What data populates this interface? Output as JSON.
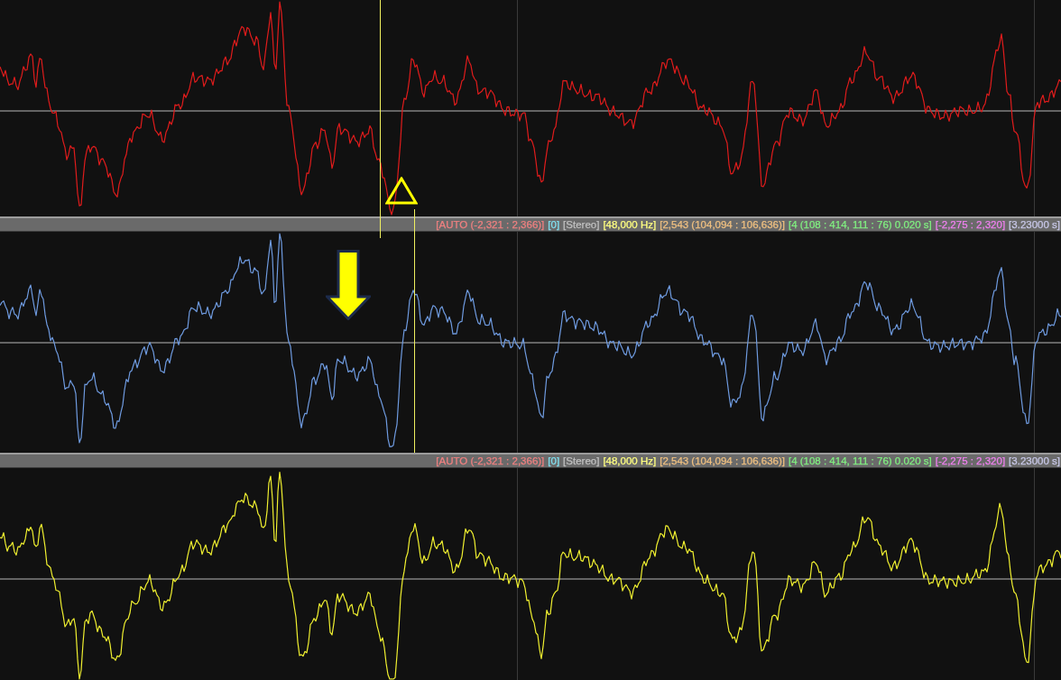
{
  "tracks": [
    {
      "color": "#e01c1c",
      "status_bar": [
        {
          "text": "[AUTO (-2,321 : 2,366)]",
          "color": "#f08080"
        },
        {
          "text": "[0]",
          "color": "#80e0f0"
        },
        {
          "text": "[Stereo]",
          "color": "#c0c0c0"
        },
        {
          "text": "[48,000 Hz]",
          "color": "#ffff80"
        },
        {
          "text": "[2,543 (104,094 : 106,636)]",
          "color": "#f0c080"
        },
        {
          "text": "[4 (108 : 414, 111 : 76) 0.020 s]",
          "color": "#80f080"
        },
        {
          "text": "[-2,275 : 2,320]",
          "color": "#f080f0"
        },
        {
          "text": "[3.23000 s]",
          "color": "#c8c8e8"
        }
      ]
    },
    {
      "color": "#6f9be0",
      "status_bar": [
        {
          "text": "[AUTO (-2,321 : 2,366)]",
          "color": "#f08080"
        },
        {
          "text": "[0]",
          "color": "#80e0f0"
        },
        {
          "text": "[Stereo]",
          "color": "#c0c0c0"
        },
        {
          "text": "[48,000 Hz]",
          "color": "#ffff80"
        },
        {
          "text": "[2,543 (104,094 : 106,636)]",
          "color": "#f0c080"
        },
        {
          "text": "[4 (108 : 414, 111 : 76) 0.020 s]",
          "color": "#80f080"
        },
        {
          "text": "[-2,275 : 2,320]",
          "color": "#f080f0"
        },
        {
          "text": "[3.23000 s]",
          "color": "#c8c8e8"
        }
      ]
    },
    {
      "color": "#f0f030"
    }
  ]
}
